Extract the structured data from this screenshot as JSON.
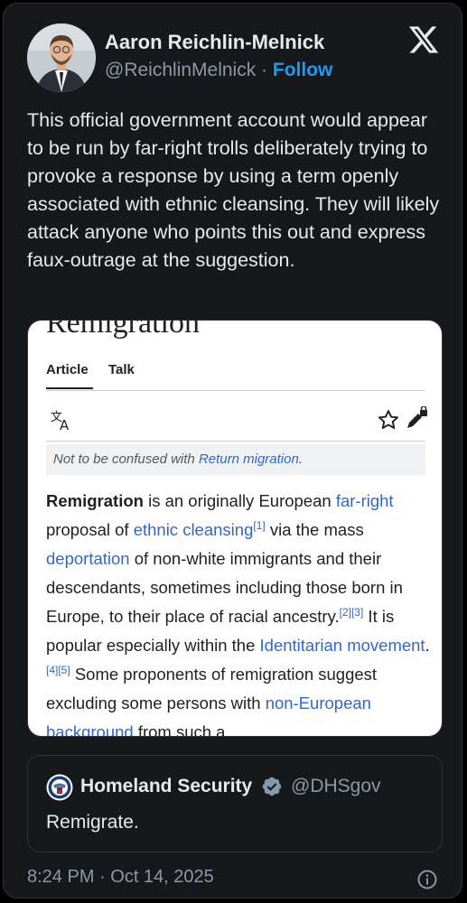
{
  "author": {
    "name": "Aaron Reichlin-Melnick",
    "handle": "@ReichlinMelnick",
    "separator": "·",
    "follow_label": "Follow"
  },
  "tweet": {
    "text": "This official government account would appear to be run by far-right trolls deliberately trying to provoke a response by using a term openly associated with ethnic cleansing. They will likely attack anyone who points this out and express faux-outrage at the suggestion."
  },
  "wiki": {
    "title": "Remigration",
    "tabs": [
      "Article",
      "Talk"
    ],
    "hatnote_prefix": "Not to be confused with ",
    "hatnote_link": "Return migration",
    "hatnote_suffix": ".",
    "paragraph": [
      {
        "t": "Remigration",
        "b": true
      },
      {
        "t": " is an originally European "
      },
      {
        "t": "far-right",
        "link": true
      },
      {
        "t": " proposal of "
      },
      {
        "t": "ethnic cleansing",
        "link": true
      },
      {
        "t": "[1]",
        "sup": true
      },
      {
        "t": " via the mass "
      },
      {
        "t": "deportation",
        "link": true
      },
      {
        "t": " of non-white immigrants and their descendants, sometimes including those born in Europe, to their place of racial ancestry."
      },
      {
        "t": "[2][3]",
        "sup": true
      },
      {
        "t": " It is popular especially within the "
      },
      {
        "t": "Identitarian movement",
        "link": true
      },
      {
        "t": ".",
        "link": false
      },
      {
        "t": "[4][5]",
        "sup": true
      },
      {
        "t": " Some proponents of remigration suggest excluding some persons with "
      },
      {
        "t": "non-European background",
        "link": true
      },
      {
        "t": " from such a"
      }
    ]
  },
  "quote": {
    "name": "Homeland Security",
    "handle": "@DHSgov",
    "text": "Remigrate."
  },
  "timestamp": "8:24 PM · Oct 14, 2025",
  "colors": {
    "accent": "#1d9bf0",
    "background": "#16181c",
    "link": "#3366cc"
  },
  "icons": [
    "x-logo-icon",
    "translate-icon",
    "star-icon",
    "edit-lock-icon",
    "verified-icon",
    "info-icon",
    "dhs-seal-icon"
  ]
}
